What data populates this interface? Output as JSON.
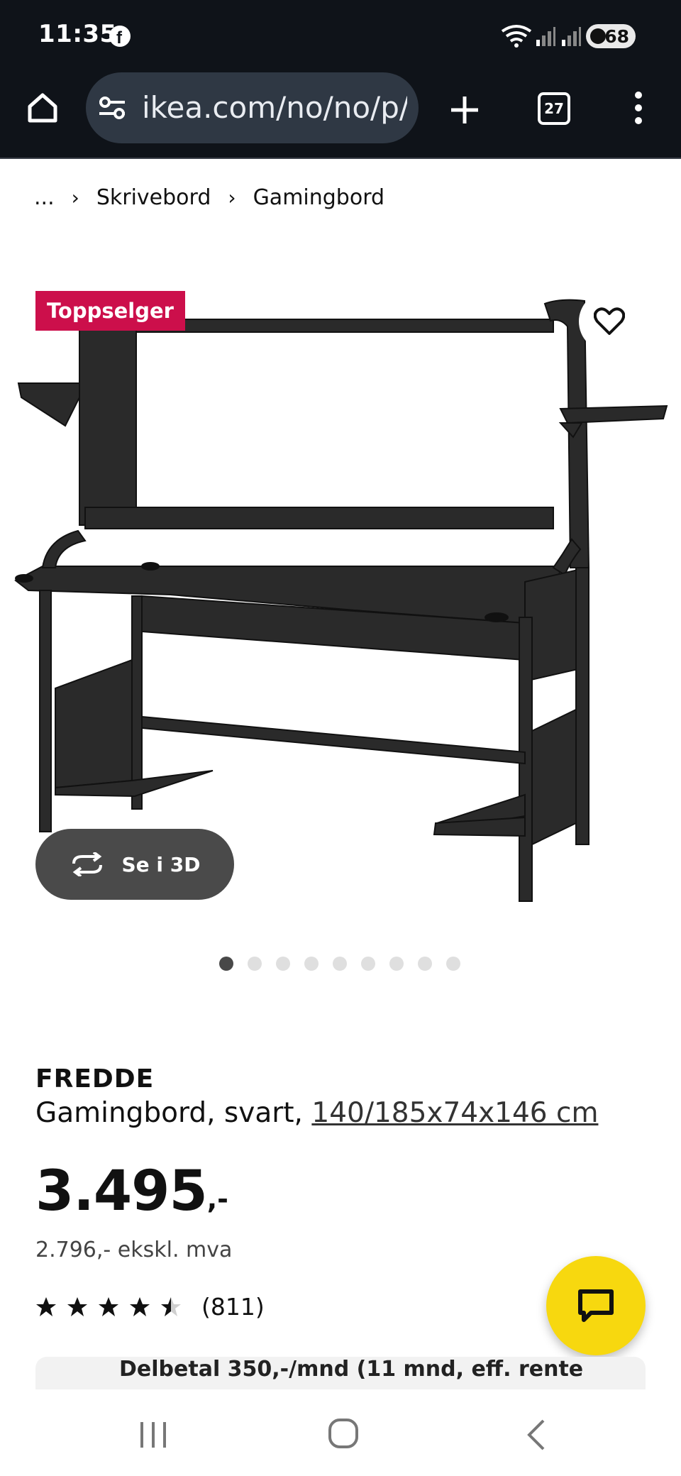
{
  "status": {
    "time": "11:35",
    "battery": "68"
  },
  "browser": {
    "url": "ikea.com/no/no/p/fredde",
    "tab_count": "27"
  },
  "breadcrumb": {
    "ellipsis": "...",
    "items": [
      "Skrivebord",
      "Gamingbord"
    ]
  },
  "product": {
    "badge": "Toppselger",
    "view_3d": "Se i 3D",
    "dots": {
      "count": 9,
      "active": 1
    },
    "name": "FREDDE",
    "description": "Gamingbord, svart,",
    "dimensions": "140/185x74x146 cm",
    "price": "3.495",
    "price_suffix": ",-",
    "price_ex_vat": "2.796,- ekskl. mva",
    "rating": 4.5,
    "rating_count": "(811)"
  },
  "payment_banner": "Delbetal 350,-/mnd (11 mnd, eff. rente"
}
